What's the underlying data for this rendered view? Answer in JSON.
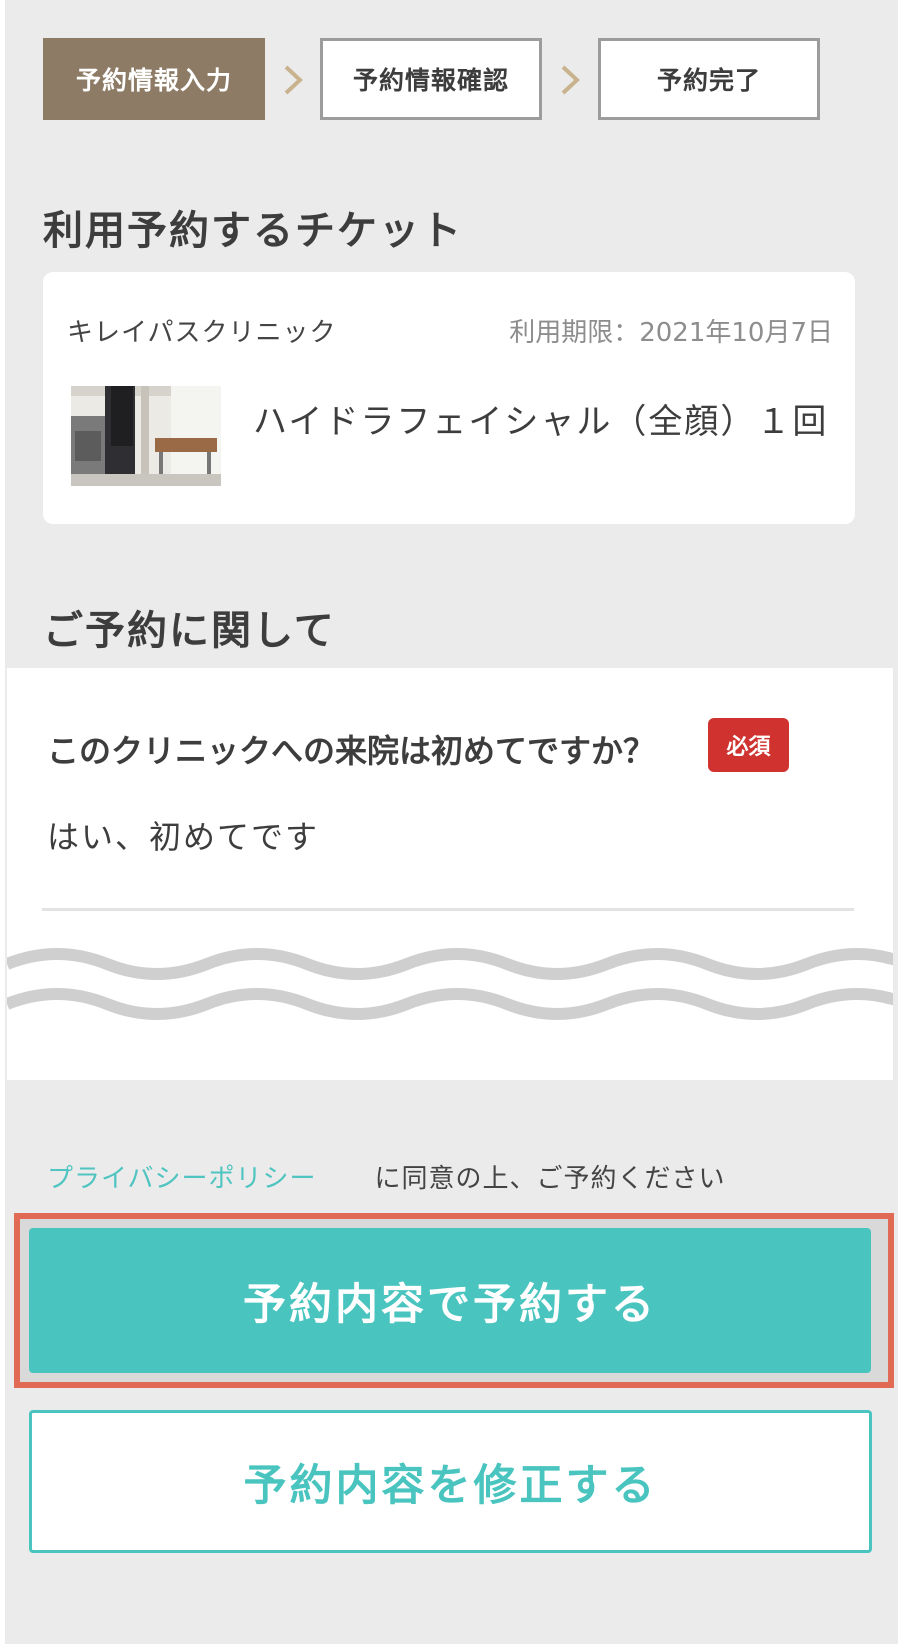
{
  "steps": [
    {
      "label": "予約情報入力",
      "state": "active"
    },
    {
      "label": "予約情報確認",
      "state": "inactive"
    },
    {
      "label": "予約完了",
      "state": "inactive"
    }
  ],
  "ticket_section": {
    "title": "利用予約するチケット",
    "clinic_name": "キレイパスクリニック",
    "expiry": "利用期限：2021年10月7日",
    "ticket_name": "ハイドラフェイシャル（全顔）１回"
  },
  "reservation_section": {
    "title": "ご予約に関して",
    "question": "このクリニックへの来院は初めてですか？",
    "required_badge": "必須",
    "answer": "はい、初めてです"
  },
  "consent": {
    "link": "プライバシーポリシー",
    "text": "に同意の上、ご予約ください"
  },
  "buttons": {
    "confirm": "予約内容で予約する",
    "edit": "予約内容を修正する"
  },
  "colors": {
    "step_active": "#8d7b66",
    "accent": "#49c4bf",
    "required": "#d0332f",
    "highlight_frame": "#e06a53"
  }
}
